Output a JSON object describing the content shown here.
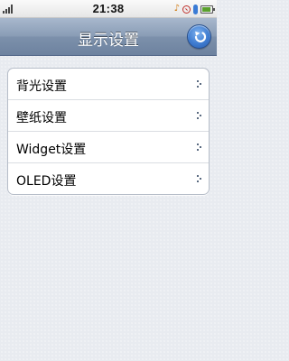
{
  "status_bar": {
    "time": "21:38",
    "icons": [
      "signal-icon",
      "music-icon",
      "mute-icon",
      "bluetooth-icon",
      "battery-icon"
    ]
  },
  "header": {
    "title": "显示设置",
    "back_icon": "back-arrow-icon"
  },
  "menu": {
    "items": [
      {
        "label": "背光设置"
      },
      {
        "label": "壁纸设置"
      },
      {
        "label": "Widget设置"
      },
      {
        "label": "OLED设置"
      }
    ]
  },
  "colors": {
    "title_bar": "#8a9db6",
    "back_button": "#3f7cd0",
    "background": "#e8ebf0"
  }
}
